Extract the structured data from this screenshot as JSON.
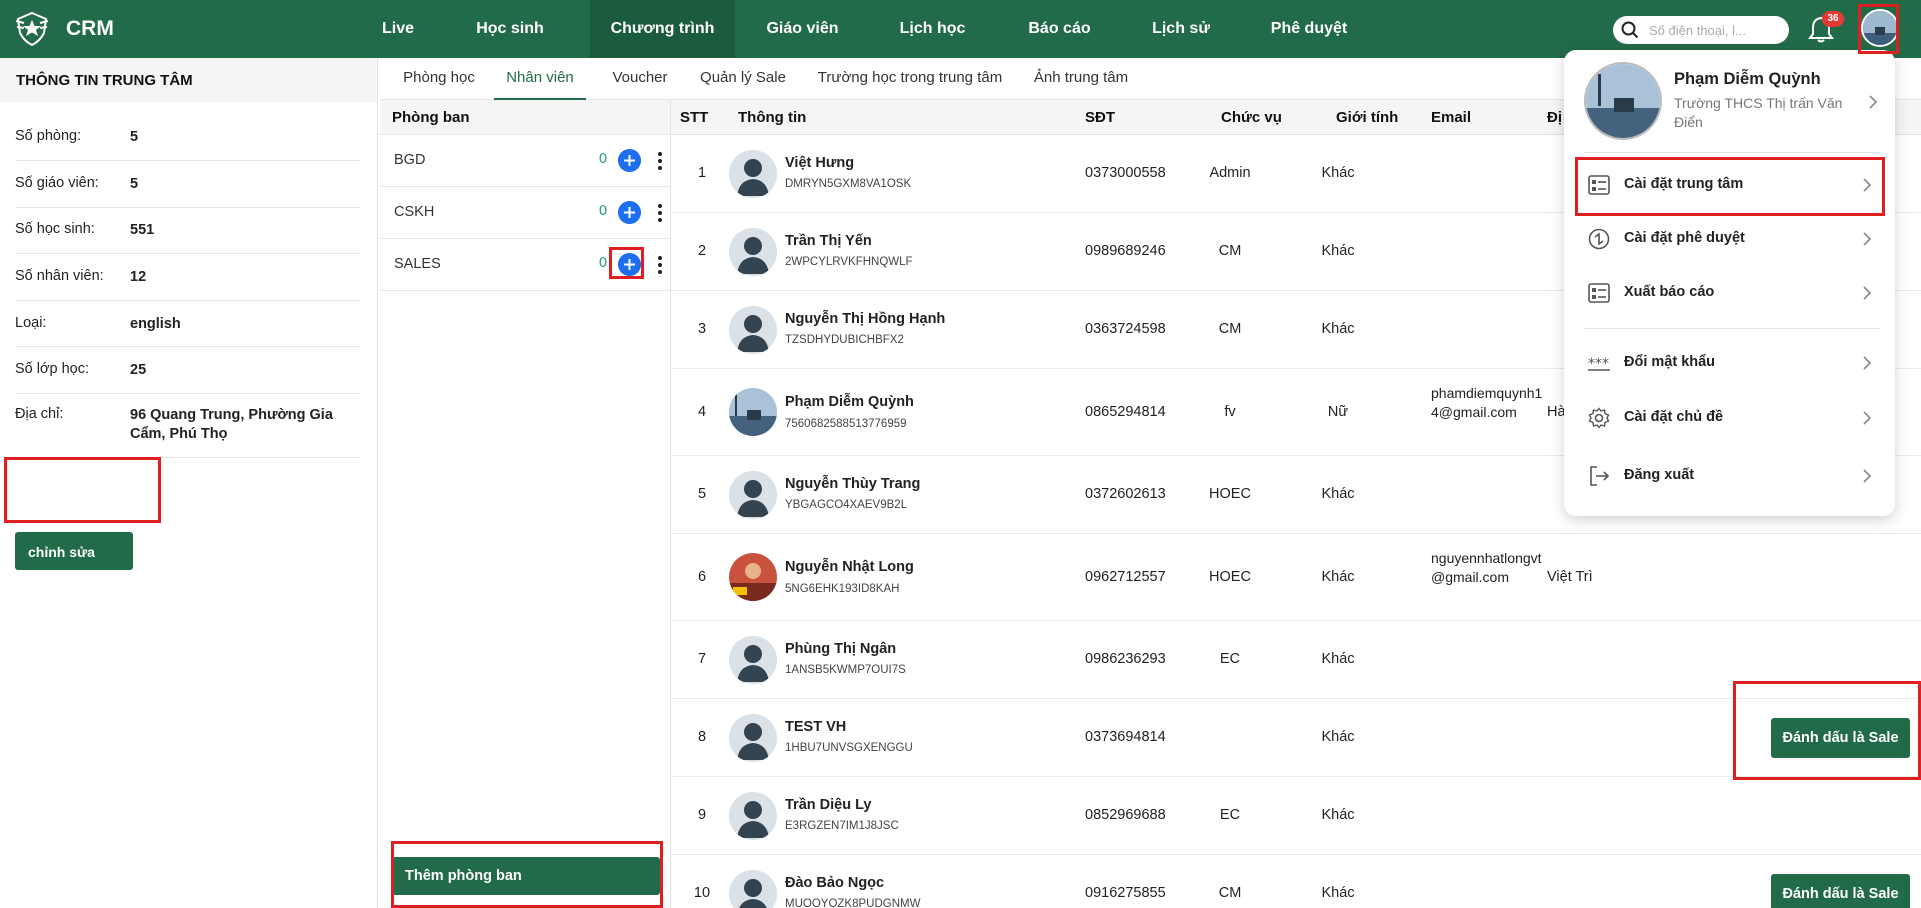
{
  "app": {
    "brand": "CRM"
  },
  "nav": {
    "items": [
      {
        "label": "Live"
      },
      {
        "label": "Học sinh"
      },
      {
        "label": "Chương trình",
        "active": true
      },
      {
        "label": "Giáo viên"
      },
      {
        "label": "Lịch học"
      },
      {
        "label": "Báo cáo"
      },
      {
        "label": "Lịch sử"
      },
      {
        "label": "Phê duyệt"
      }
    ],
    "search_placeholder": "Số điện thoại, l...",
    "notification_count": "36"
  },
  "center_info": {
    "title": "THÔNG TIN TRUNG TÂM",
    "rows": [
      {
        "label": "Số phòng:",
        "value": "5"
      },
      {
        "label": "Số giáo viên:",
        "value": "5"
      },
      {
        "label": "Số học sinh:",
        "value": "551"
      },
      {
        "label": "Số nhân viên:",
        "value": "12"
      },
      {
        "label": "Loại:",
        "value": "english"
      },
      {
        "label": "Số lớp học:",
        "value": "25"
      },
      {
        "label": "Địa chỉ:",
        "value": "96 Quang Trung, Phường Gia Cẩm, Phú Thọ"
      }
    ],
    "edit_button": "chỉnh sửa"
  },
  "tabs": [
    {
      "label": "Phòng học"
    },
    {
      "label": "Nhân viên",
      "active": true
    },
    {
      "label": "Voucher"
    },
    {
      "label": "Quản lý Sale"
    },
    {
      "label": "Trường học trong trung tâm"
    },
    {
      "label": "Ảnh trung tâm"
    }
  ],
  "departments": {
    "header": "Phòng ban",
    "items": [
      {
        "name": "BGD",
        "count": "0"
      },
      {
        "name": "CSKH",
        "count": "0"
      },
      {
        "name": "SALES",
        "count": "0"
      }
    ],
    "add_button": "Thêm phòng ban"
  },
  "employees": {
    "columns": [
      "STT",
      "Thông tin",
      "SĐT",
      "Chức vụ",
      "Giới tính",
      "Email",
      "Đị"
    ],
    "rows": [
      {
        "stt": "1",
        "name": "Việt Hưng",
        "code": "DMRYN5GXM8VA1OSK",
        "phone": "0373000558",
        "position": "Admin",
        "gender": "Khác",
        "email": "",
        "address": "",
        "avatar": "default"
      },
      {
        "stt": "2",
        "name": "Trần Thị Yến",
        "code": "2WPCYLRVKFHNQWLF",
        "phone": "0989689246",
        "position": "CM",
        "gender": "Khác",
        "email": "",
        "address": "",
        "avatar": "default"
      },
      {
        "stt": "3",
        "name": "Nguyễn Thị Hồng Hạnh",
        "code": "TZSDHYDUBICHBFX2",
        "phone": "0363724598",
        "position": "CM",
        "gender": "Khác",
        "email": "",
        "address": "",
        "avatar": "default"
      },
      {
        "stt": "4",
        "name": "Phạm Diễm Quỳnh",
        "code": "7560682588513776959",
        "phone": "0865294814",
        "position": "fv",
        "gender": "Nữ",
        "email": "phamdiemquynh14@gmail.com",
        "address": "Hà",
        "avatar": "photo-sea"
      },
      {
        "stt": "5",
        "name": "Nguyễn Thùy Trang",
        "code": "YBGAGCO4XAEV9B2L",
        "phone": "0372602613",
        "position": "HOEC",
        "gender": "Khác",
        "email": "",
        "address": "",
        "avatar": "default"
      },
      {
        "stt": "6",
        "name": "Nguyễn Nhật Long",
        "code": "5NG6EHK193ID8KAH",
        "phone": "0962712557",
        "position": "HOEC",
        "gender": "Khác",
        "email": "nguyennhatlongvt@gmail.com",
        "address": "Việt Trì",
        "avatar": "photo-red"
      },
      {
        "stt": "7",
        "name": "Phùng Thị Ngân",
        "code": "1ANSB5KWMP7OUI7S",
        "phone": "0986236293",
        "position": "EC",
        "gender": "Khác",
        "email": "",
        "address": "",
        "avatar": "default"
      },
      {
        "stt": "8",
        "name": "TEST VH",
        "code": "1HBU7UNVSGXENGGU",
        "phone": "0373694814",
        "position": "",
        "gender": "Khác",
        "email": "",
        "address": "",
        "avatar": "default",
        "sale_button": "Đánh dấu là Sale"
      },
      {
        "stt": "9",
        "name": "Trần Diệu Ly",
        "code": "E3RGZEN7IM1J8JSC",
        "phone": "0852969688",
        "position": "EC",
        "gender": "Khác",
        "email": "",
        "address": "",
        "avatar": "default"
      },
      {
        "stt": "10",
        "name": "Đào Bảo Ngọc",
        "code": "MUOOYOZK8PUDGNMW",
        "phone": "0916275855",
        "position": "CM",
        "gender": "Khác",
        "email": "",
        "address": "",
        "avatar": "default",
        "sale_button": "Đánh dấu là Sale"
      }
    ]
  },
  "user_menu": {
    "name": "Phạm Diễm Quỳnh",
    "school": "Trường THCS Thị trấn Văn Điển",
    "items": [
      {
        "label": "Cài đặt trung tâm",
        "icon": "settings-list-icon"
      },
      {
        "label": "Cài đặt phê duyệt",
        "icon": "approval-icon"
      },
      {
        "label": "Xuất báo cáo",
        "icon": "report-icon"
      },
      {
        "label": "Đổi mật khẩu",
        "icon": "password-icon"
      },
      {
        "label": "Cài đặt chủ đề",
        "icon": "gear-icon"
      },
      {
        "label": "Đăng xuất",
        "icon": "logout-icon"
      }
    ]
  },
  "colors": {
    "primary": "#226b48",
    "highlight": "#e02020",
    "count": "#22a06b",
    "add": "#1e6ff0"
  }
}
